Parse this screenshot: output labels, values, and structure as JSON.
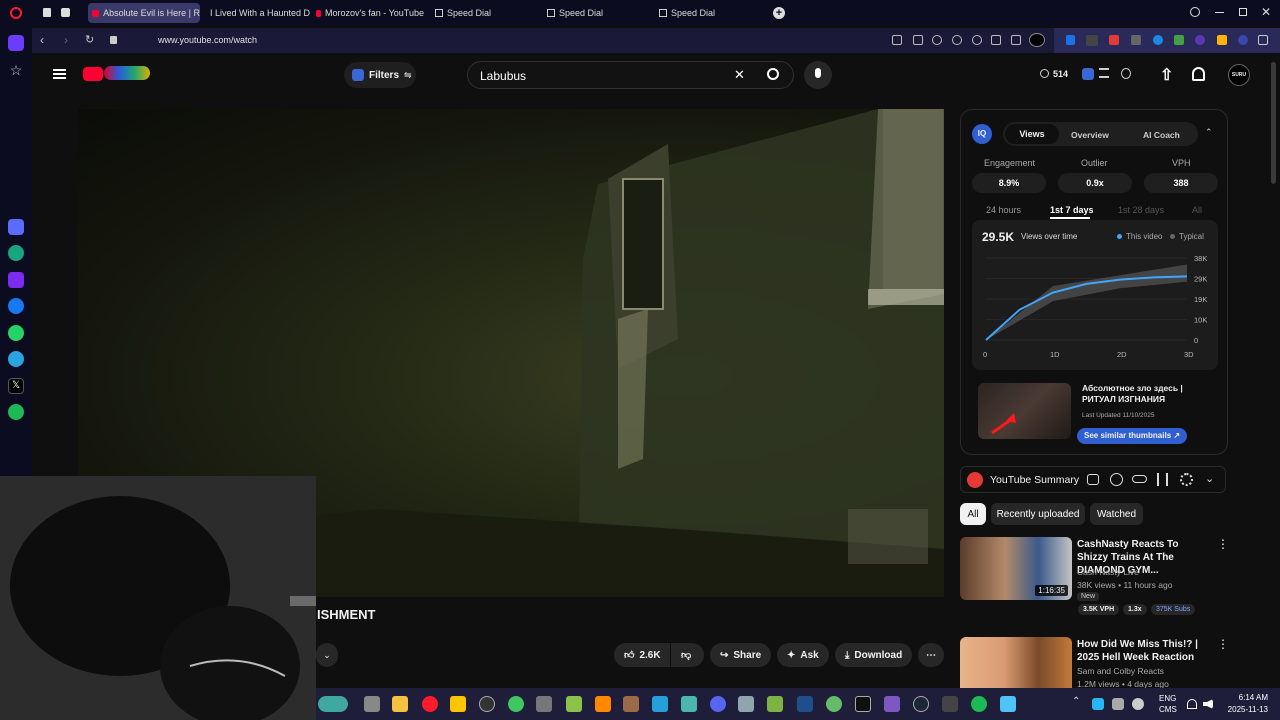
{
  "tabs": [
    {
      "label": "Absolute Evil is Here | R",
      "active": true
    },
    {
      "label": "I Lived With a Haunted Do"
    },
    {
      "label": "Morozov's fan - YouTube"
    },
    {
      "label": "Speed Dial"
    },
    {
      "label": "Speed Dial"
    },
    {
      "label": "Speed Dial"
    }
  ],
  "address": {
    "url": "www.youtube.com/watch"
  },
  "header": {
    "filters_label": "Filters",
    "search_value": "Labubus",
    "count_badge": "514",
    "avatar_text": "SURU"
  },
  "video": {
    "title_fragment": "ISHMENT"
  },
  "actions": {
    "likes": "2.6K",
    "share": "Share",
    "ask": "Ask",
    "download": "Download"
  },
  "iq": {
    "logo": "IQ",
    "tabs": [
      "Views",
      "Overview",
      "AI Coach"
    ],
    "metrics": [
      {
        "label": "Engagement",
        "value": "8.9%"
      },
      {
        "label": "Outlier",
        "value": "0.9x"
      },
      {
        "label": "VPH",
        "value": "388"
      }
    ],
    "ranges": [
      "24 hours",
      "1st 7 days",
      "1st 28 days",
      "All"
    ],
    "total_views": "29.5K",
    "views_over_time": "Views over time",
    "legend_this": "This video",
    "legend_typical": "Typical",
    "thumb_title": "Абсолютное зло здесь | РИТУАЛ ИЗГНАНИЯ",
    "last_updated": "Last Updated 11/10/2025",
    "similar_btn": "See similar thumbnails ↗"
  },
  "chart_data": {
    "type": "area",
    "x": [
      "0",
      "1D",
      "2D",
      "3D"
    ],
    "ylim": [
      0,
      38000
    ],
    "yticks": [
      "38K",
      "29K",
      "19K",
      "10K",
      "0"
    ],
    "series": [
      {
        "name": "This video",
        "points": [
          [
            0,
            0
          ],
          [
            0.5,
            14000
          ],
          [
            1,
            22000
          ],
          [
            1.5,
            26000
          ],
          [
            2,
            28000
          ],
          [
            2.5,
            29000
          ],
          [
            3,
            29500
          ]
        ]
      },
      {
        "name": "Typical",
        "band_low": [
          [
            0,
            0
          ],
          [
            1,
            18000
          ],
          [
            2,
            24000
          ],
          [
            3,
            27000
          ]
        ],
        "band_high": [
          [
            0,
            0
          ],
          [
            1,
            25000
          ],
          [
            2,
            30000
          ],
          [
            3,
            35000
          ]
        ]
      }
    ],
    "colors": {
      "this": "#3ea6ff",
      "typical": "#555555"
    }
  },
  "summary": {
    "title": "YouTube Summary"
  },
  "chips": [
    "All",
    "Recently uploaded",
    "Watched"
  ],
  "recs": [
    {
      "title": "CashNasty Reacts To Shizzy Trains At The DIAMOND GYM...",
      "channel": "Cash Nasty Live",
      "meta": "38K views • 11 hours ago",
      "badge": "New",
      "duration": "1:16:35",
      "vph": "3.5K VPH",
      "mult": "1.3x",
      "subs": "375K Subs"
    },
    {
      "title": "How Did We Miss This!? | 2025 Hell Week Reaction",
      "channel": "Sam and Colby Reacts",
      "meta": "1.2M views • 4 days ago"
    }
  ],
  "taskbar": {
    "lang": "ENG",
    "ime": "CMS",
    "time": "6:14 AM",
    "date": "2025-11-13"
  }
}
